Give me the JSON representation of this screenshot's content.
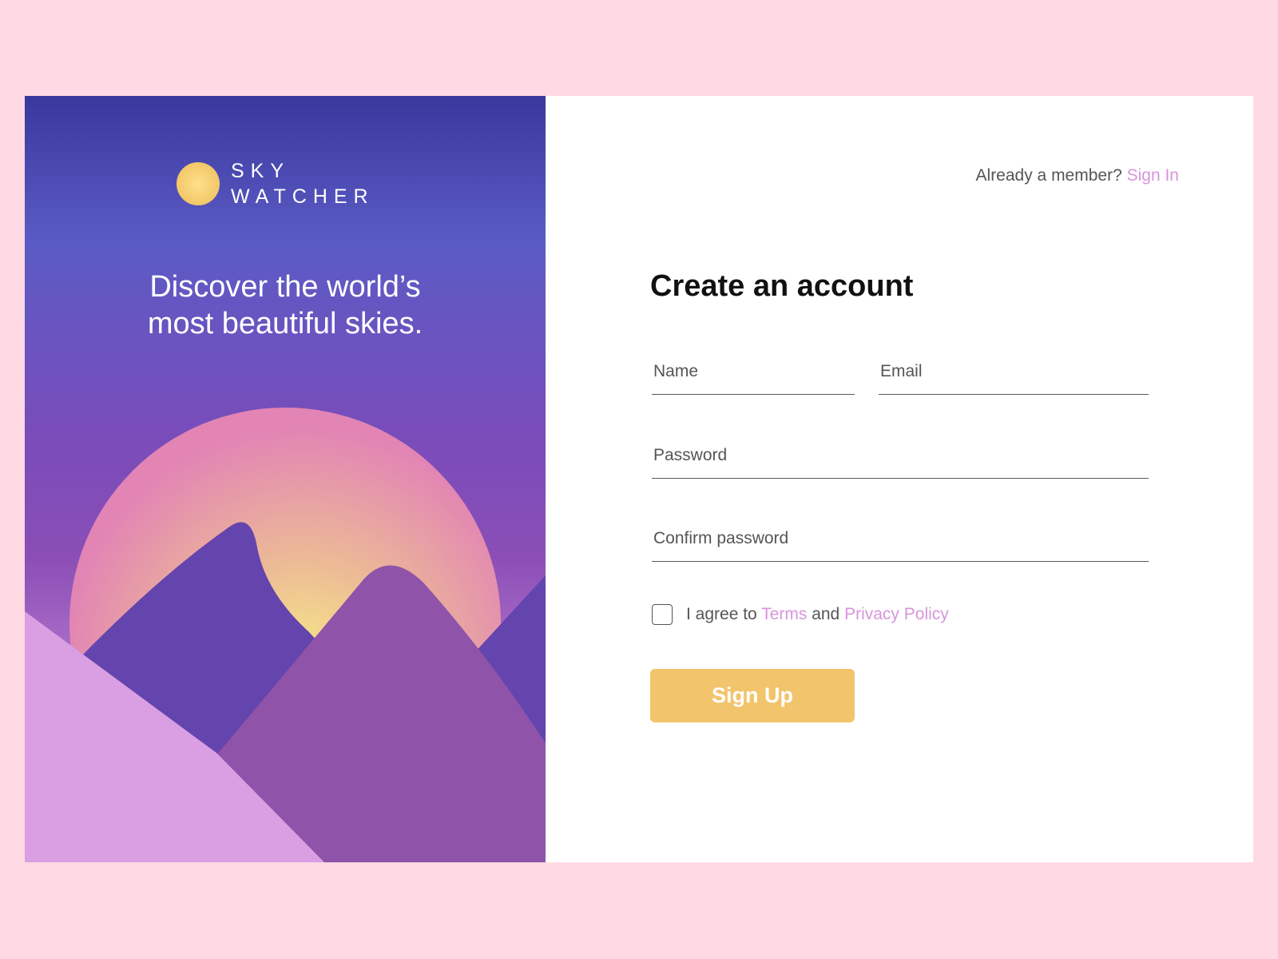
{
  "brand": {
    "line1": "SKY",
    "line2": "WATCHER"
  },
  "hero": {
    "tagline_line1": "Discover the world’s",
    "tagline_line2": "most beautiful skies."
  },
  "header": {
    "member_prompt": "Already a member?",
    "sign_in_label": "Sign In"
  },
  "form": {
    "title": "Create an account",
    "name": {
      "placeholder": "Name",
      "value": ""
    },
    "email": {
      "placeholder": "Email",
      "value": ""
    },
    "password": {
      "placeholder": "Password",
      "value": ""
    },
    "confirm_password": {
      "placeholder": "Confirm password",
      "value": ""
    },
    "agree": {
      "prefix": "I agree to ",
      "terms_label": "Terms",
      "middle": " and ",
      "privacy_label": "Privacy Policy",
      "checked": false
    },
    "submit_label": "Sign Up"
  },
  "colors": {
    "page_background": "#ffd9e3",
    "accent_link": "#d795dc",
    "button": "#f2c46c",
    "sky_top": "#3a389d",
    "sun": "#f2c768"
  },
  "icons": {
    "logo": "sun-icon",
    "checkbox": "checkbox-icon"
  }
}
